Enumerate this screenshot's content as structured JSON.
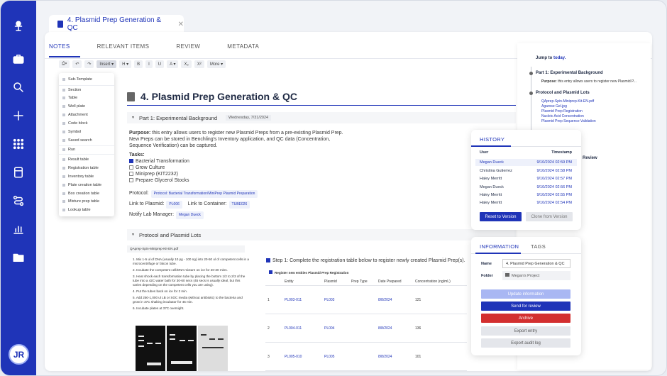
{
  "nav": {
    "avatar_initials": "JR"
  },
  "tab": {
    "title": "4. Plasmid Prep Generation & QC",
    "close": "✕"
  },
  "subtabs": [
    "NOTES",
    "RELEVANT ITEMS",
    "REVIEW",
    "METADATA"
  ],
  "toolbar": {
    "insert": "Insert ▾",
    "heading": "H ▾",
    "bold": "B",
    "italic": "I",
    "underline": "U",
    "color": "A ▾",
    "sub": "X₂",
    "sup": "X²",
    "more": "More ▾"
  },
  "insert_menu": [
    "Sub-Template",
    "Section",
    "Table",
    "Well plate",
    "Attachment",
    "Code block",
    "Symbol",
    "Saved search",
    "Run",
    "Result table",
    "Registration table",
    "Inventory table",
    "Plate creation table",
    "Box creation table",
    "Mixture prep table",
    "Lookup table"
  ],
  "doc": {
    "title": "4. Plasmid Prep Generation & QC",
    "section1": "Part 1: Experimental Background",
    "section1_date": "Wednesday, 7/31/2024",
    "purpose_label": "Purpose:",
    "purpose_l1": "this entry allows users to register new Plasmid Preps from a pre-existing Plasmid Prep.",
    "purpose_l2": "New Preps can be stored in Benchling's Inventory application, and QC data (Concentration,",
    "purpose_l3": "Sequence Verification) can be captured.",
    "tasks_label": "Tasks:",
    "tasks": [
      "Bacterial Transformation",
      "Grow Culture",
      "Miniprep (KIT2232)",
      "Prepare Glycerol Stocks"
    ],
    "protocol_label": "Protocol:",
    "protocol_chip": "Protocol: Bacterial Transformation/MiniPrep Plasmid Preparation",
    "plasmid_label": "Link to Plasmid:",
    "plasmid_chip": "PL006",
    "container_label": "Link to Container:",
    "container_chip": "TUBE026",
    "notify_label": "Notify Lab Manager:",
    "notify_chip": "Megan Dueck",
    "section2": "Protocol and Plasmid Lots",
    "file_name": "QAprep-Spin-Miniprep-Kit-EN.pdf",
    "steps": [
      "1.  Mix 1-5 ul of DNA (usually 10 pg - 100 ng) into 20-50 ul of competent cells in a",
      "     microcentrifuge or falcon tube.",
      "2.  Incubate the competent cell/DNA mixture on ice for 20-30 mins.",
      "3.  Heat shock each transformation tube by placing the bottom 1/2 to 2/3 of the",
      "     tube into a 42C water bath for 30-60 secs (45 secs is usually ideal, but this",
      "     varies depending on the competent cells you are using).",
      "4.  Put the tubes back on ice for 2 min.",
      "5.  Add 250-1,000 ul LB or SOC media (without antibiotic) to the bacteria and",
      "     grow in 37C shaking incubator for 45 min.",
      "6.  Incubate plates at 37C overnight."
    ],
    "step1_label": "Step 1: Complete the registration table below to register newly created Plasmid Prep(s).",
    "reg_title": "Register new entities Plasmid Prep Registration",
    "reg_headers": [
      "Entity",
      "Plasmid",
      "Prep Type",
      "Date Prepared",
      "Concentration (ng/mL)"
    ],
    "reg_rows": [
      {
        "n": "1",
        "entity": "PL003-011",
        "plasmid": "PL003",
        "date": "8/8/2024",
        "conc": "121"
      },
      {
        "n": "2",
        "entity": "PL004-011",
        "plasmid": "PL004",
        "date": "8/8/2024",
        "conc": "136"
      },
      {
        "n": "3",
        "entity": "PL005-010",
        "plasmid": "PL005",
        "date": "8/8/2024",
        "conc": "101"
      }
    ]
  },
  "outline": {
    "jump": "Jump to",
    "today": "today.",
    "s1": "Part 1: Experimental Background",
    "s1_purpose_label": "Purpose:",
    "s1_purpose": "this entry allows users to register new Plasmid P...",
    "s2": "Protocol and Plasmid Lots",
    "s2_items": [
      "QAprep-Spin-Miniprep-Kit-EN.pdf",
      "Agarose Gel.jpg",
      "Plasmid Prep Registration",
      "Nucleic Acid Concentration",
      "Plasmid Prep Sequence Validation"
    ],
    "s3": "Review"
  },
  "history": {
    "title": "HISTORY",
    "user_h": "User",
    "ts_h": "Timestamp",
    "rows": [
      {
        "u": "Megan Dueck",
        "t": "9/10/2024 02:59 PM"
      },
      {
        "u": "Christina Gutierrez",
        "t": "9/10/2024 02:58 PM"
      },
      {
        "u": "Haley Merritt",
        "t": "9/10/2024 02:57 PM"
      },
      {
        "u": "Megan Dueck",
        "t": "9/10/2024 02:56 PM"
      },
      {
        "u": "Haley Merritt",
        "t": "9/10/2024 02:55 PM"
      },
      {
        "u": "Haley Merritt",
        "t": "9/10/2024 02:54 PM"
      }
    ],
    "reset": "Reset to Version",
    "clone": "Clone from Version"
  },
  "info": {
    "tab1": "INFORMATION",
    "tab2": "TAGS",
    "name_label": "Name",
    "name_value": "4. Plasmid Prep Generation & QC",
    "folder_label": "Folder",
    "folder_value": "Megan's Project",
    "update": "Update information",
    "send": "Send for review",
    "archive": "Archive",
    "export": "Export entry",
    "audit": "Export audit log"
  },
  "colors": {
    "brand": "#1f34b8",
    "archive": "#d32f2f"
  }
}
